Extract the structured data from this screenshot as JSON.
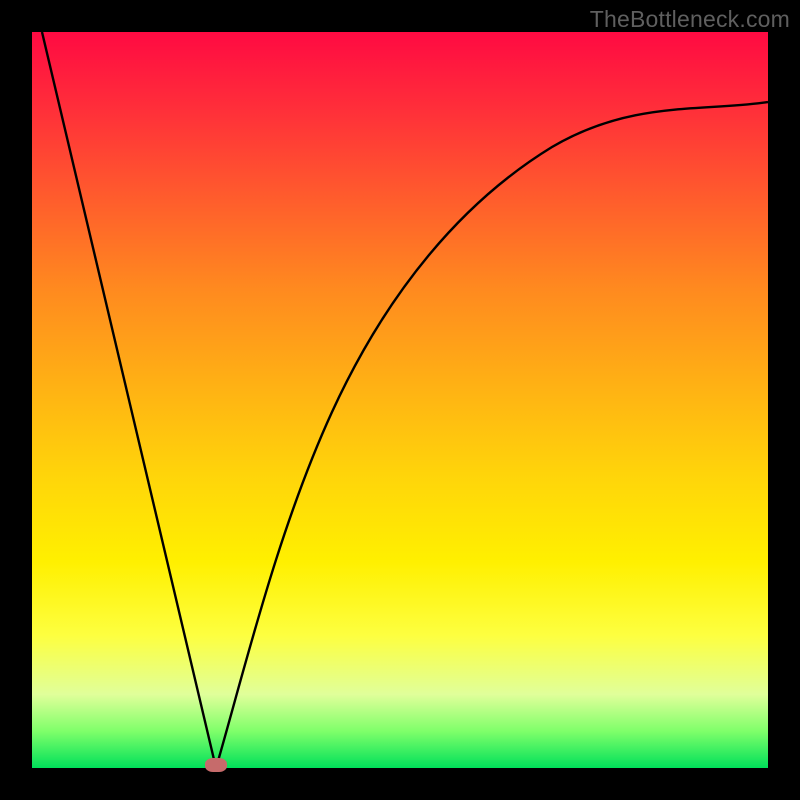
{
  "watermark": {
    "text": "TheBottleneck.com"
  },
  "chart_data": {
    "type": "line",
    "title": "",
    "xlabel": "",
    "ylabel": "",
    "xlim": [
      0,
      100
    ],
    "ylim": [
      0,
      100
    ],
    "grid": false,
    "legend": false,
    "minimum_marker": {
      "x": 25,
      "y": 0
    },
    "series": [
      {
        "name": "curve",
        "x": [
          0,
          5,
          10,
          15,
          20,
          23,
          25,
          27,
          30,
          35,
          40,
          45,
          50,
          55,
          60,
          65,
          70,
          75,
          80,
          85,
          90,
          95,
          100
        ],
        "y": [
          100,
          80,
          60,
          40,
          20,
          8,
          0,
          6,
          16,
          32,
          45,
          55,
          63,
          69,
          74,
          78,
          81,
          83.5,
          85.5,
          87,
          88,
          89,
          90
        ]
      }
    ],
    "background_gradient": {
      "top": "#ff0a42",
      "middle": "#ffd000",
      "bottom": "#00e05a"
    }
  }
}
